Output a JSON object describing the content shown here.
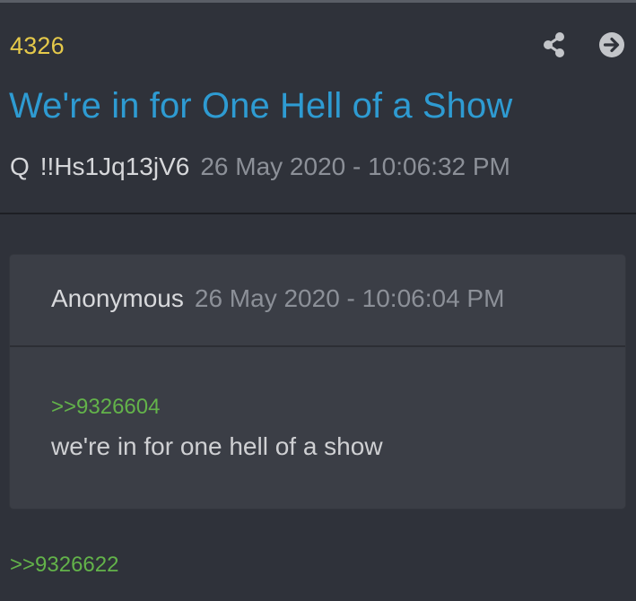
{
  "post": {
    "number": "4326",
    "title": "We're in for One Hell of a Show",
    "author": "Q",
    "tripcode": "!!Hs1Jq13jV6",
    "timestamp": "26 May 2020 - 10:06:32 PM"
  },
  "header_actions": {
    "share_icon": "share-icon",
    "open_icon": "arrow-right-circle-icon"
  },
  "quoted_post": {
    "author": "Anonymous",
    "timestamp": "26 May 2020 - 10:06:04 PM",
    "reply_link": ">>9326604",
    "message": "we're in for one hell of a show"
  },
  "footer": {
    "reply_link": ">>9326622"
  },
  "colors": {
    "background": "#2f323a",
    "card": "#3b3e46",
    "post_number": "#e5c94a",
    "title": "#2e9bd2",
    "reply_link": "#63b34a",
    "muted": "#8c9098"
  }
}
